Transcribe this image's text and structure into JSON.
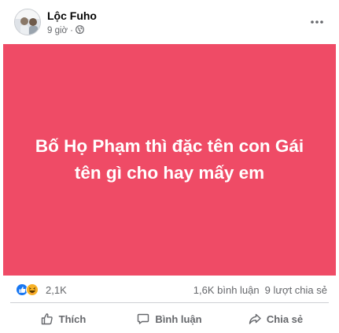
{
  "post": {
    "author": "Lộc Fuho",
    "time": "9 giờ",
    "separator": "·",
    "audience_icon": "globe-icon",
    "banner_color": "#ef4b66",
    "text_line1": "Bố Họ Phạm thì đặc tên con Gái",
    "text_line2": "tên gì cho hay mấy em"
  },
  "stats": {
    "reaction_icons": [
      "like-icon",
      "haha-icon"
    ],
    "reactions": "2,1K",
    "comments": "1,6K bình luận",
    "shares": "9 lượt chia sẻ"
  },
  "actions": {
    "like_label": "Thích",
    "comment_label": "Bình luận",
    "share_label": "Chia sẻ"
  }
}
